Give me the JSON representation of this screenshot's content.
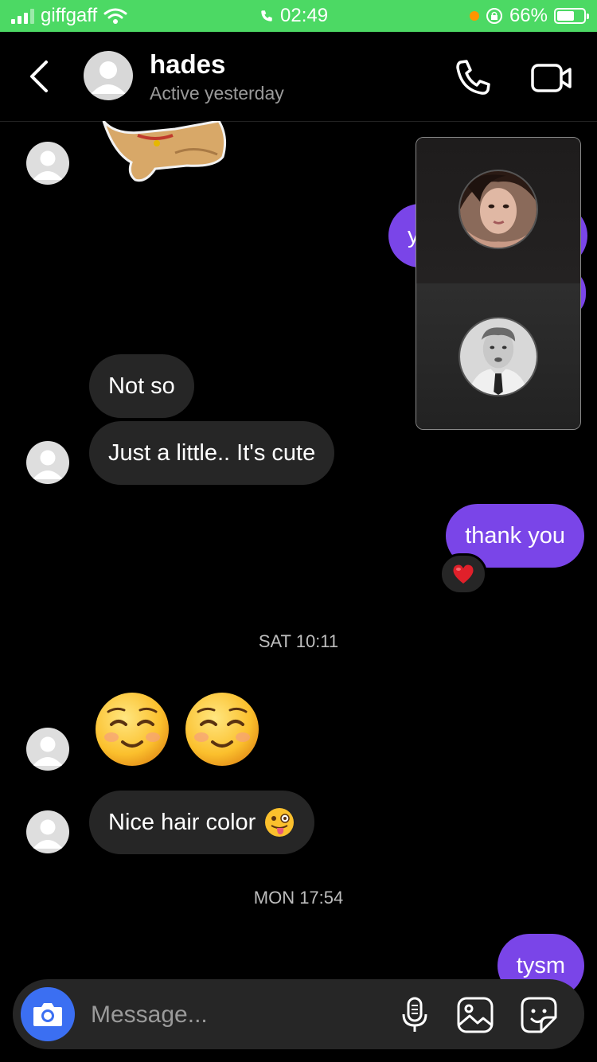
{
  "status_bar": {
    "carrier": "giffgaff",
    "time": "02:49",
    "battery": "66%",
    "battery_level": 0.66,
    "status_color": "#4cd964"
  },
  "header": {
    "contact_name": "hades",
    "contact_status": "Active yesterday",
    "icons": [
      "chevron-left-icon",
      "phone-icon",
      "video-camera-icon"
    ]
  },
  "conversation": {
    "partial_outgoing_letter": "y",
    "messages_1": [
      {
        "from": "them",
        "text": "Not so"
      },
      {
        "from": "them",
        "text": "Just a little.. It's cute"
      },
      {
        "from": "me",
        "text": "thank you",
        "reaction": "❤️"
      }
    ],
    "timestamp_1": "SAT 10:11",
    "emoji_message": "☺️☺️",
    "hair_message": "Nice hair color",
    "hair_message_emoji": "😜",
    "timestamp_2": "MON 17:54",
    "last_message": "tysm"
  },
  "composer": {
    "placeholder": "Message...",
    "icons": [
      "camera-icon",
      "microphone-icon",
      "gallery-icon",
      "sticker-icon"
    ]
  },
  "colors": {
    "outgoing_bubble": "#7a45e8",
    "incoming_bubble": "#262626",
    "camera_button": "#3b6ff2"
  }
}
